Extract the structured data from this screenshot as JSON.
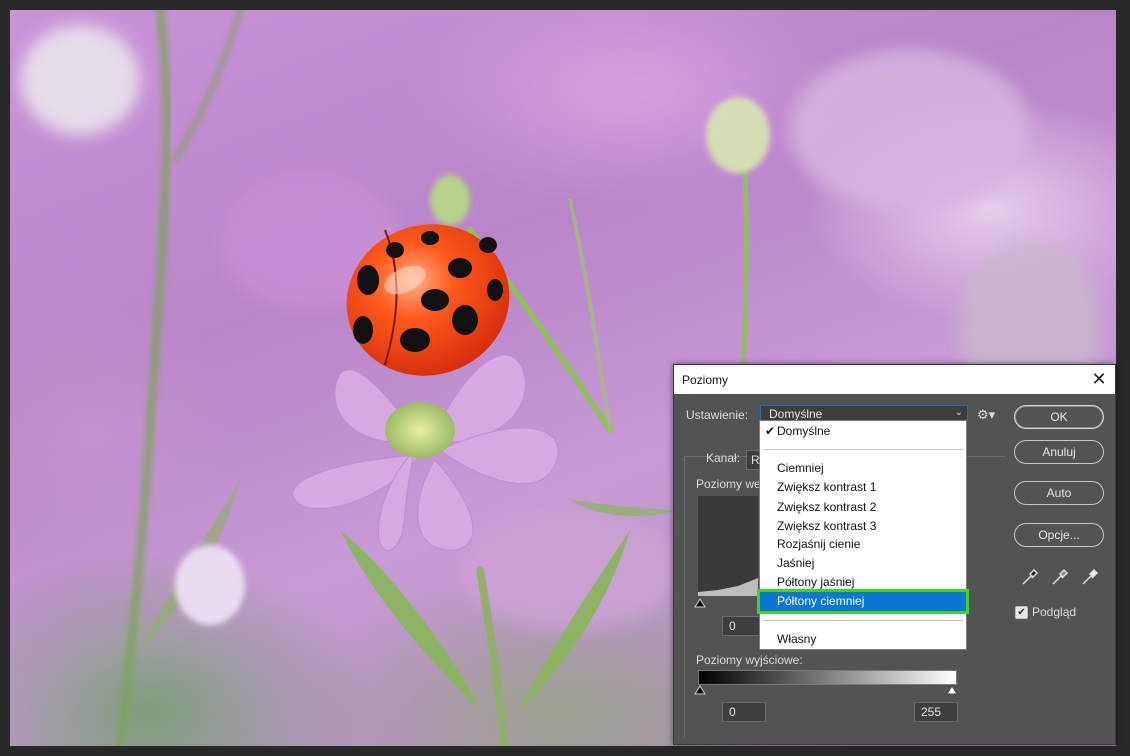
{
  "dialog": {
    "title": "Poziomy",
    "close_glyph": "✕",
    "preset_label": "Ustawienie:",
    "preset_value": "Domyślne",
    "channel_label": "Kanał:",
    "channel_value": "RGB",
    "input_levels_label": "Poziomy we",
    "input_black": "0",
    "output_levels_label": "Poziomy wyjściowe:",
    "output_black": "0",
    "output_white": "255",
    "buttons": {
      "ok": "OK",
      "cancel": "Anuluj",
      "auto": "Auto",
      "options": "Opcje..."
    },
    "preview_label": "Podgląd",
    "preview_checked": true,
    "icons": [
      "gear-icon",
      "black-point-eyedropper-icon",
      "gray-point-eyedropper-icon",
      "white-point-eyedropper-icon"
    ]
  },
  "preset_menu": {
    "items": [
      {
        "label": "Domyślne",
        "checked": true
      },
      {
        "label": "Ciemniej"
      },
      {
        "label": "Zwiększ kontrast 1"
      },
      {
        "label": "Zwiększ kontrast 2"
      },
      {
        "label": "Zwiększ kontrast 3"
      },
      {
        "label": "Rozjaśnij cienie"
      },
      {
        "label": "Jaśniej"
      },
      {
        "label": "Półtony jaśniej"
      },
      {
        "label": "Półtony ciemniej",
        "highlighted": true
      },
      {
        "label": "Własny"
      }
    ]
  },
  "colors": {
    "accent": "#0a76d6",
    "highlight_outline": "#44d41e",
    "dialog_bg": "#535353"
  }
}
